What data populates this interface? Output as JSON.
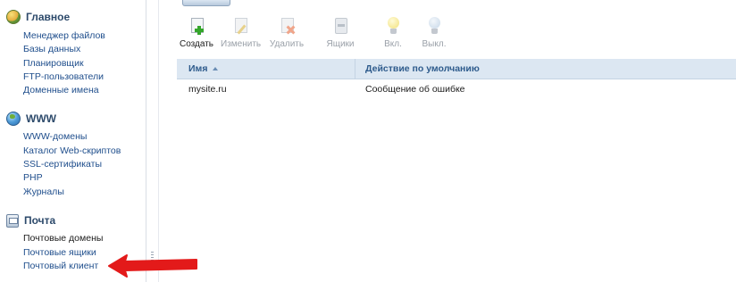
{
  "sidebar": {
    "sections": [
      {
        "title": "Главное",
        "icon": "home-icon",
        "items": [
          "Менеджер файлов",
          "Базы данных",
          "Планировщик",
          "FTP-пользователи",
          "Доменные имена"
        ]
      },
      {
        "title": "WWW",
        "icon": "globe-icon",
        "items": [
          "WWW-домены",
          "Каталог Web-скриптов",
          "SSL-сертификаты",
          "PHP",
          "Журналы"
        ]
      },
      {
        "title": "Почта",
        "icon": "mail-icon",
        "items": [
          "Почтовые домены",
          "Почтовые ящики",
          "Почтовый клиент"
        ]
      }
    ],
    "active_item": "Почтовые домены"
  },
  "toolbar": {
    "buttons": [
      {
        "label": "Создать",
        "icon": "add-document-icon",
        "enabled": true
      },
      {
        "label": "Изменить",
        "icon": "edit-icon",
        "enabled": false
      },
      {
        "label": "Удалить",
        "icon": "delete-icon",
        "enabled": false
      },
      {
        "label": "Ящики",
        "icon": "mailbox-icon",
        "enabled": false
      },
      {
        "label": "Вкл.",
        "icon": "bulb-on-icon",
        "enabled": false
      },
      {
        "label": "Выкл.",
        "icon": "bulb-off-icon",
        "enabled": false
      }
    ]
  },
  "table": {
    "columns": [
      "Имя",
      "Действие по умолчанию"
    ],
    "sort_column": "Имя",
    "rows": [
      [
        "mysite.ru",
        "Сообщение об ошибке"
      ]
    ]
  },
  "colors": {
    "link": "#1f4e8c",
    "header_bg": "#dce7f2",
    "header_text": "#2e5b8c",
    "annotation_arrow": "#e31a1a"
  }
}
